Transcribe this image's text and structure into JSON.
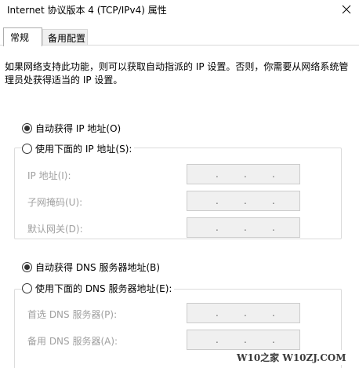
{
  "window": {
    "title": "Internet 协议版本 4 (TCP/IPv4) 属性",
    "close_icon": "close-icon"
  },
  "tabs": [
    {
      "label": "常规",
      "active": true
    },
    {
      "label": "备用配置",
      "active": false
    }
  ],
  "description": "如果网络支持此功能，则可以获取自动指派的 IP 设置。否则，你需要从网络系统管理员处获得适当的 IP 设置。",
  "ip_section": {
    "auto_label": "自动获得 IP 地址(O)",
    "auto_selected": true,
    "manual_label": "使用下面的 IP 地址(S):",
    "manual_selected": false,
    "fields": [
      {
        "label": "IP 地址(I):",
        "value": ".   .   ."
      },
      {
        "label": "子网掩码(U):",
        "value": ".   .   ."
      },
      {
        "label": "默认网关(D):",
        "value": ".   .   ."
      }
    ]
  },
  "dns_section": {
    "auto_label": "自动获得 DNS 服务器地址(B)",
    "auto_selected": true,
    "manual_label": "使用下面的 DNS 服务器地址(E):",
    "manual_selected": false,
    "fields": [
      {
        "label": "首选 DNS 服务器(P):",
        "value": ".   .   ."
      },
      {
        "label": "备用 DNS 服务器(A):",
        "value": ".   .   ."
      }
    ]
  },
  "watermark": "W10之家 W10ZJ.COM"
}
